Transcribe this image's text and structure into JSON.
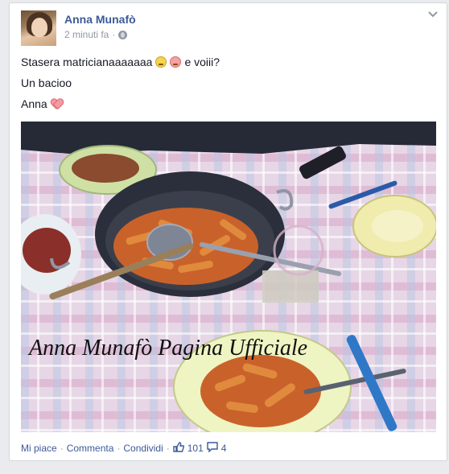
{
  "post": {
    "author": "Anna Munafò",
    "time": "2 minuti fa",
    "separator": "·",
    "line1": "Stasera matricianaaaaaaa",
    "line1_end": "e voiii?",
    "line2": "Un bacioo",
    "line3": "Anna",
    "watermark": "Anna Munafò Pagina Ufficiale"
  },
  "actions": {
    "like": "Mi piace",
    "comment": "Commenta",
    "share": "Condividi",
    "sep": "·",
    "likes_count": "101",
    "comments_count": "4"
  },
  "icons": {
    "privacy": "globe-icon",
    "menu": "chevron-down-icon",
    "likes": "thumbs-up-icon",
    "comments": "comment-icon"
  },
  "colors": {
    "link": "#3b5998",
    "meta": "#9197a3"
  }
}
